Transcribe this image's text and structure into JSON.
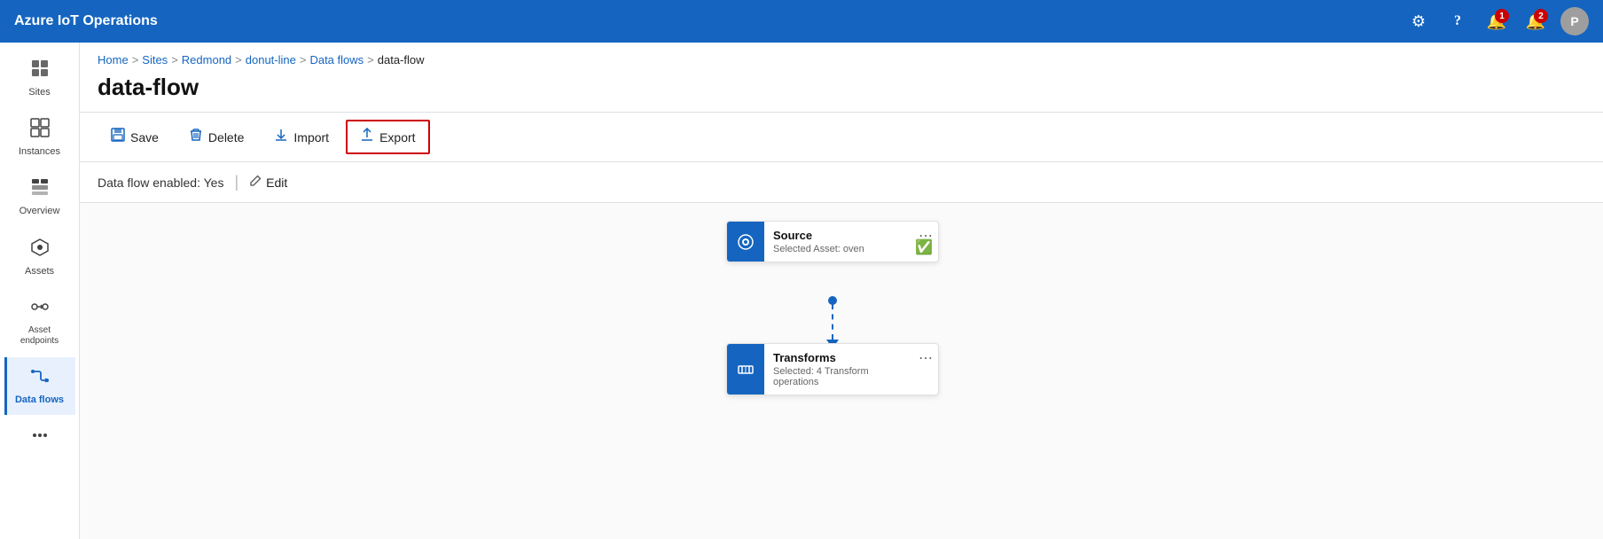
{
  "header": {
    "title": "Azure IoT Operations",
    "icons": {
      "settings": "⚙",
      "help": "?",
      "notification1_label": "notifications",
      "notification1_count": "1",
      "notification2_label": "alerts",
      "notification2_count": "2",
      "avatar_label": "P"
    }
  },
  "sidebar": {
    "items": [
      {
        "id": "sites",
        "label": "Sites",
        "icon": "⊞"
      },
      {
        "id": "instances",
        "label": "Instances",
        "icon": "⧉"
      },
      {
        "id": "overview",
        "label": "Overview",
        "icon": "▦"
      },
      {
        "id": "assets",
        "label": "Assets",
        "icon": "✦"
      },
      {
        "id": "asset-endpoints",
        "label": "Asset endpoints",
        "icon": "⇄"
      },
      {
        "id": "data-flows",
        "label": "Data flows",
        "icon": "⋈"
      },
      {
        "id": "more",
        "label": "",
        "icon": "⊕"
      }
    ],
    "active": "data-flows"
  },
  "breadcrumb": {
    "items": [
      "Home",
      "Sites",
      "Redmond",
      "donut-line",
      "Data flows"
    ],
    "current": "data-flow",
    "separators": [
      ">",
      ">",
      ">",
      ">",
      ">"
    ]
  },
  "page": {
    "title": "data-flow"
  },
  "toolbar": {
    "save_label": "Save",
    "delete_label": "Delete",
    "import_label": "Import",
    "export_label": "Export",
    "save_icon": "💾",
    "delete_icon": "🗑",
    "import_icon": "⬇",
    "export_icon": "⬆"
  },
  "info_bar": {
    "enabled_text": "Data flow enabled: Yes",
    "edit_label": "Edit"
  },
  "flow": {
    "source_node": {
      "title": "Source",
      "subtitle": "Selected Asset: oven",
      "status": "✅"
    },
    "transforms_node": {
      "title": "Transforms",
      "subtitle": "Selected: 4 Transform operations"
    }
  }
}
